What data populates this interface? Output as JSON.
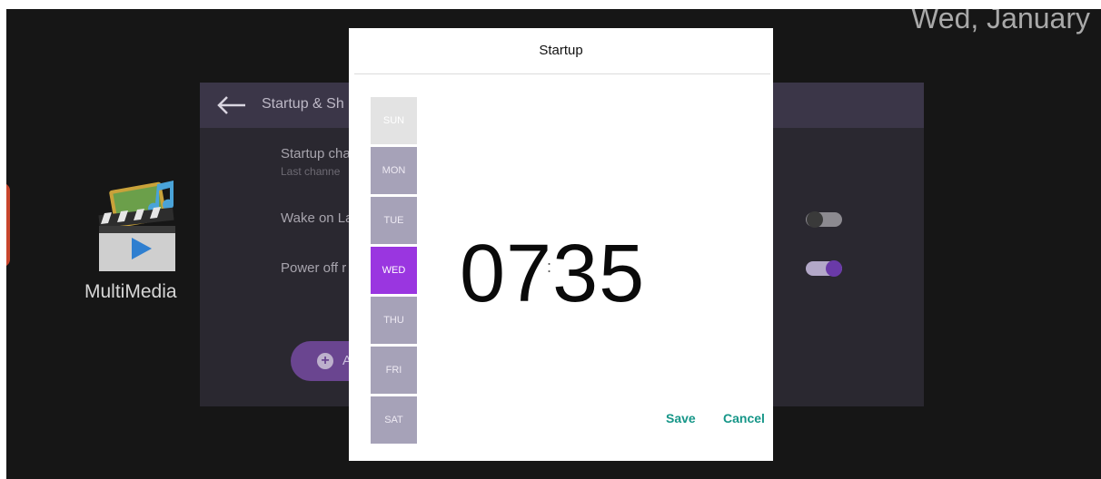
{
  "status_bar": {
    "date": "Wed, January"
  },
  "launcher": {
    "multimedia_label": "MultiMedia"
  },
  "settings_panel": {
    "title": "Startup & Sh",
    "rows": [
      {
        "title": "Startup cha",
        "subtitle": "Last channe"
      },
      {
        "title": "Wake on La",
        "toggle_on": false
      },
      {
        "title": "Power off r",
        "toggle_on": true
      }
    ],
    "add_label": "A"
  },
  "dialog": {
    "title": "Startup",
    "days": [
      {
        "label": "SUN",
        "state": "disabled"
      },
      {
        "label": "MON",
        "state": "normal"
      },
      {
        "label": "TUE",
        "state": "normal"
      },
      {
        "label": "WED",
        "state": "selected"
      },
      {
        "label": "THU",
        "state": "normal"
      },
      {
        "label": "FRI",
        "state": "normal"
      },
      {
        "label": "SAT",
        "state": "normal"
      }
    ],
    "time": {
      "hours": "07",
      "minutes": "35",
      "separator": ":"
    },
    "save_label": "Save",
    "cancel_label": "Cancel"
  },
  "colors": {
    "accent_purple": "#9a36e0",
    "action_teal": "#169688",
    "day_normal": "#a6a2b8",
    "day_disabled": "#e3e3e3",
    "toggle_on_track": "#b3a8c8",
    "toggle_on_knob": "#6a3aa8",
    "toggle_off_track": "#8c8a90",
    "toggle_off_knob": "#3a3a3a"
  }
}
